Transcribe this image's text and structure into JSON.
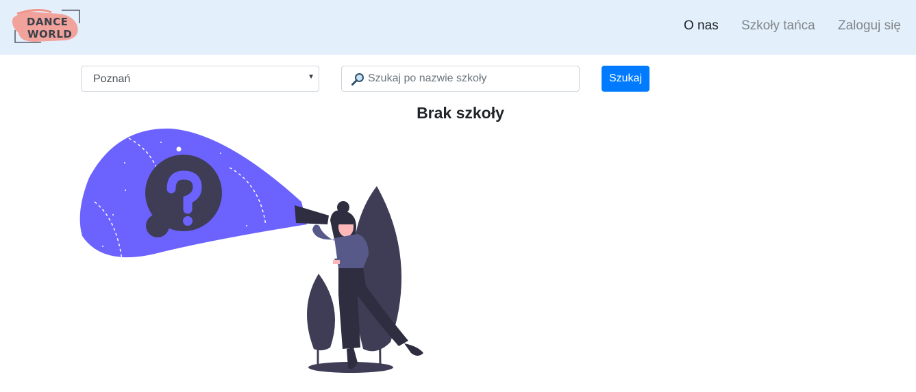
{
  "brand": {
    "line1": "DANCE",
    "line2": "WORLD",
    "accent": "#f2948a"
  },
  "nav": {
    "about": "O nas",
    "schools": "Szkoły tańca",
    "login": "Zaloguj się"
  },
  "filters": {
    "city_value": "Poznań",
    "search_placeholder": "Szukaj po nazwie szkoły",
    "search_button": "Szukaj"
  },
  "main": {
    "message": "Brak szkoły"
  },
  "colors": {
    "navbar": "#e3f0fc",
    "primary": "#007bff",
    "spotlight": "#6c63ff",
    "dark": "#3f3d56"
  }
}
